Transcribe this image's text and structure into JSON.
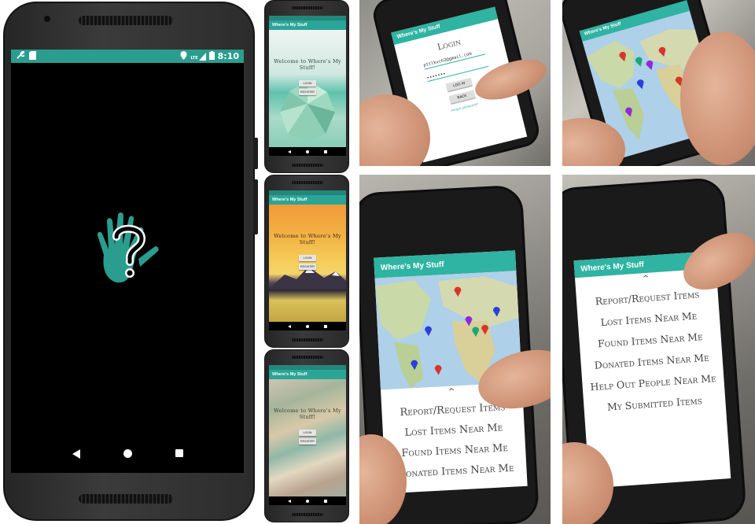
{
  "big_phone": {
    "status_time": "8:10",
    "status_lte": "LTE",
    "statusbar_color": "#2a9d8f",
    "icons": [
      "wrench-icon",
      "sdcard-icon",
      "location-icon",
      "signal-icon",
      "battery-icon"
    ]
  },
  "small_phones": [
    {
      "app_title": "Where's My Stuff",
      "welcome": "Welcome to Where's My Stuff!",
      "login_label": "LOGIN",
      "register_label": "REGISTER",
      "theme": "teal-lowpoly"
    },
    {
      "app_title": "Where's My Stuff",
      "welcome": "Welcome to Where's My Stuff!",
      "login_label": "LOGIN",
      "register_label": "REGISTER",
      "theme": "sunset-lowpoly"
    },
    {
      "app_title": "Where's My Stuff",
      "welcome": "Welcome to Where's My Stuff!",
      "login_label": "LOGIN",
      "register_label": "REGISTER",
      "theme": "pastel-lowpoly"
    }
  ],
  "login_photo": {
    "app_title": "Where's My Stuff",
    "heading": "Login",
    "email": "pttlkvch2@gmail.com",
    "password_mask": "•••••••",
    "login_label": "LOG IN",
    "back_label": "BACK",
    "forgot": "Forgot password?"
  },
  "map_photo": {
    "app_title": "Where's My Stuff"
  },
  "map_menu_photo": {
    "app_title": "Where's My Stuff",
    "menu": [
      "Report/Request Items",
      "Lost Items Near Me",
      "Found Items Near Me",
      "Donated Items Near Me"
    ]
  },
  "menu_photo": {
    "app_title": "Where's My Stuff",
    "menu": [
      "Report/Request Items",
      "Lost Items Near Me",
      "Found Items Near Me",
      "Donated Items Near Me",
      "Help Out People Near Me",
      "My Submitted Items"
    ]
  }
}
